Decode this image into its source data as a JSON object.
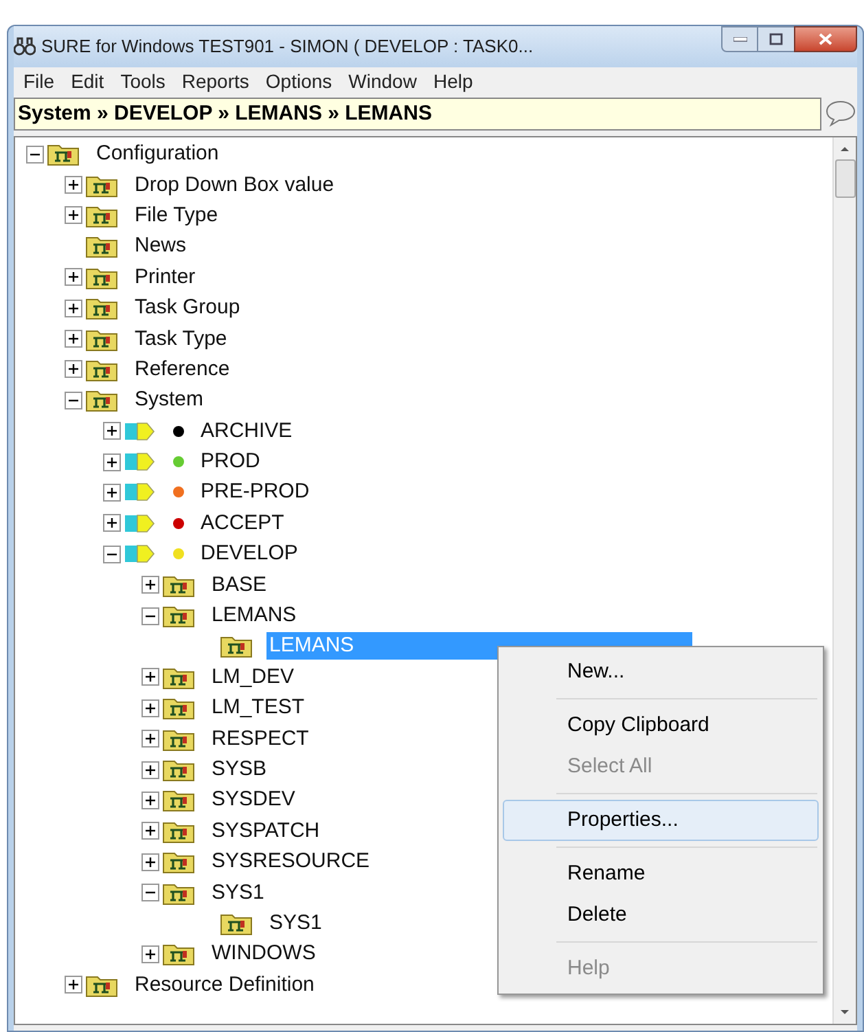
{
  "window": {
    "title": "SURE for Windows TEST901 - SIMON ( DEVELOP : TASK0..."
  },
  "menu": [
    "File",
    "Edit",
    "Tools",
    "Reports",
    "Options",
    "Window",
    "Help"
  ],
  "breadcrumb": "System » DEVELOP » LEMANS » LEMANS",
  "tree": [
    {
      "label": "Configuration",
      "kind": "folder",
      "expanded": true,
      "selected": false,
      "children": [
        {
          "label": "Drop Down Box value",
          "kind": "folder",
          "expanded": false,
          "selected": false
        },
        {
          "label": "File Type",
          "kind": "folder",
          "expanded": false,
          "selected": false
        },
        {
          "label": "News",
          "kind": "folder",
          "selected": false
        },
        {
          "label": "Printer",
          "kind": "folder",
          "expanded": false,
          "selected": false
        },
        {
          "label": "Task Group",
          "kind": "folder",
          "expanded": false,
          "selected": false
        },
        {
          "label": "Task Type",
          "kind": "folder",
          "expanded": false,
          "selected": false
        },
        {
          "label": "Reference",
          "kind": "folder",
          "expanded": false,
          "selected": false
        },
        {
          "label": "System",
          "kind": "folder",
          "expanded": true,
          "selected": false,
          "children": [
            {
              "label": "ARCHIVE",
              "kind": "environment",
              "color": "#000000",
              "expanded": false,
              "selected": false
            },
            {
              "label": "PROD",
              "kind": "environment",
              "color": "#66cc33",
              "expanded": false,
              "selected": false
            },
            {
              "label": "PRE-PROD",
              "kind": "environment",
              "color": "#f07020",
              "expanded": false,
              "selected": false
            },
            {
              "label": "ACCEPT",
              "kind": "environment",
              "color": "#cc0000",
              "expanded": false,
              "selected": false
            },
            {
              "label": "DEVELOP",
              "kind": "environment",
              "color": "#f0e020",
              "expanded": true,
              "selected": false,
              "children": [
                {
                  "label": "BASE",
                  "kind": "folder",
                  "expanded": false,
                  "selected": false
                },
                {
                  "label": "LEMANS",
                  "kind": "folder",
                  "expanded": true,
                  "selected": false,
                  "children": [
                    {
                      "label": "LEMANS",
                      "kind": "folder",
                      "selected": true
                    }
                  ]
                },
                {
                  "label": "LM_DEV",
                  "kind": "folder",
                  "expanded": false,
                  "selected": false
                },
                {
                  "label": "LM_TEST",
                  "kind": "folder",
                  "expanded": false,
                  "selected": false
                },
                {
                  "label": "RESPECT",
                  "kind": "folder",
                  "expanded": false,
                  "selected": false
                },
                {
                  "label": "SYSB",
                  "kind": "folder",
                  "expanded": false,
                  "selected": false
                },
                {
                  "label": "SYSDEV",
                  "kind": "folder",
                  "expanded": false,
                  "selected": false
                },
                {
                  "label": "SYSPATCH",
                  "kind": "folder",
                  "expanded": false,
                  "selected": false
                },
                {
                  "label": "SYSRESOURCE",
                  "kind": "folder",
                  "expanded": false,
                  "selected": false
                },
                {
                  "label": "SYS1",
                  "kind": "folder",
                  "expanded": true,
                  "selected": false,
                  "children": [
                    {
                      "label": "SYS1",
                      "kind": "folder",
                      "selected": false
                    }
                  ]
                },
                {
                  "label": "WINDOWS",
                  "kind": "folder",
                  "expanded": false,
                  "selected": false
                }
              ]
            }
          ]
        },
        {
          "label": "Resource Definition",
          "kind": "folder",
          "expanded": false,
          "selected": false
        }
      ]
    }
  ],
  "context_menu": [
    {
      "label": "New...",
      "disabled": false,
      "selected": false,
      "separator_after": true
    },
    {
      "label": "Copy Clipboard",
      "disabled": false,
      "selected": false,
      "separator_after": false
    },
    {
      "label": "Select All",
      "disabled": true,
      "selected": false,
      "separator_after": true
    },
    {
      "label": "Properties...",
      "disabled": false,
      "selected": true,
      "separator_after": true
    },
    {
      "label": "Rename",
      "disabled": false,
      "selected": false,
      "separator_after": false
    },
    {
      "label": "Delete",
      "disabled": false,
      "selected": false,
      "separator_after": true
    },
    {
      "label": "Help",
      "disabled": true,
      "selected": false,
      "separator_after": false
    }
  ]
}
